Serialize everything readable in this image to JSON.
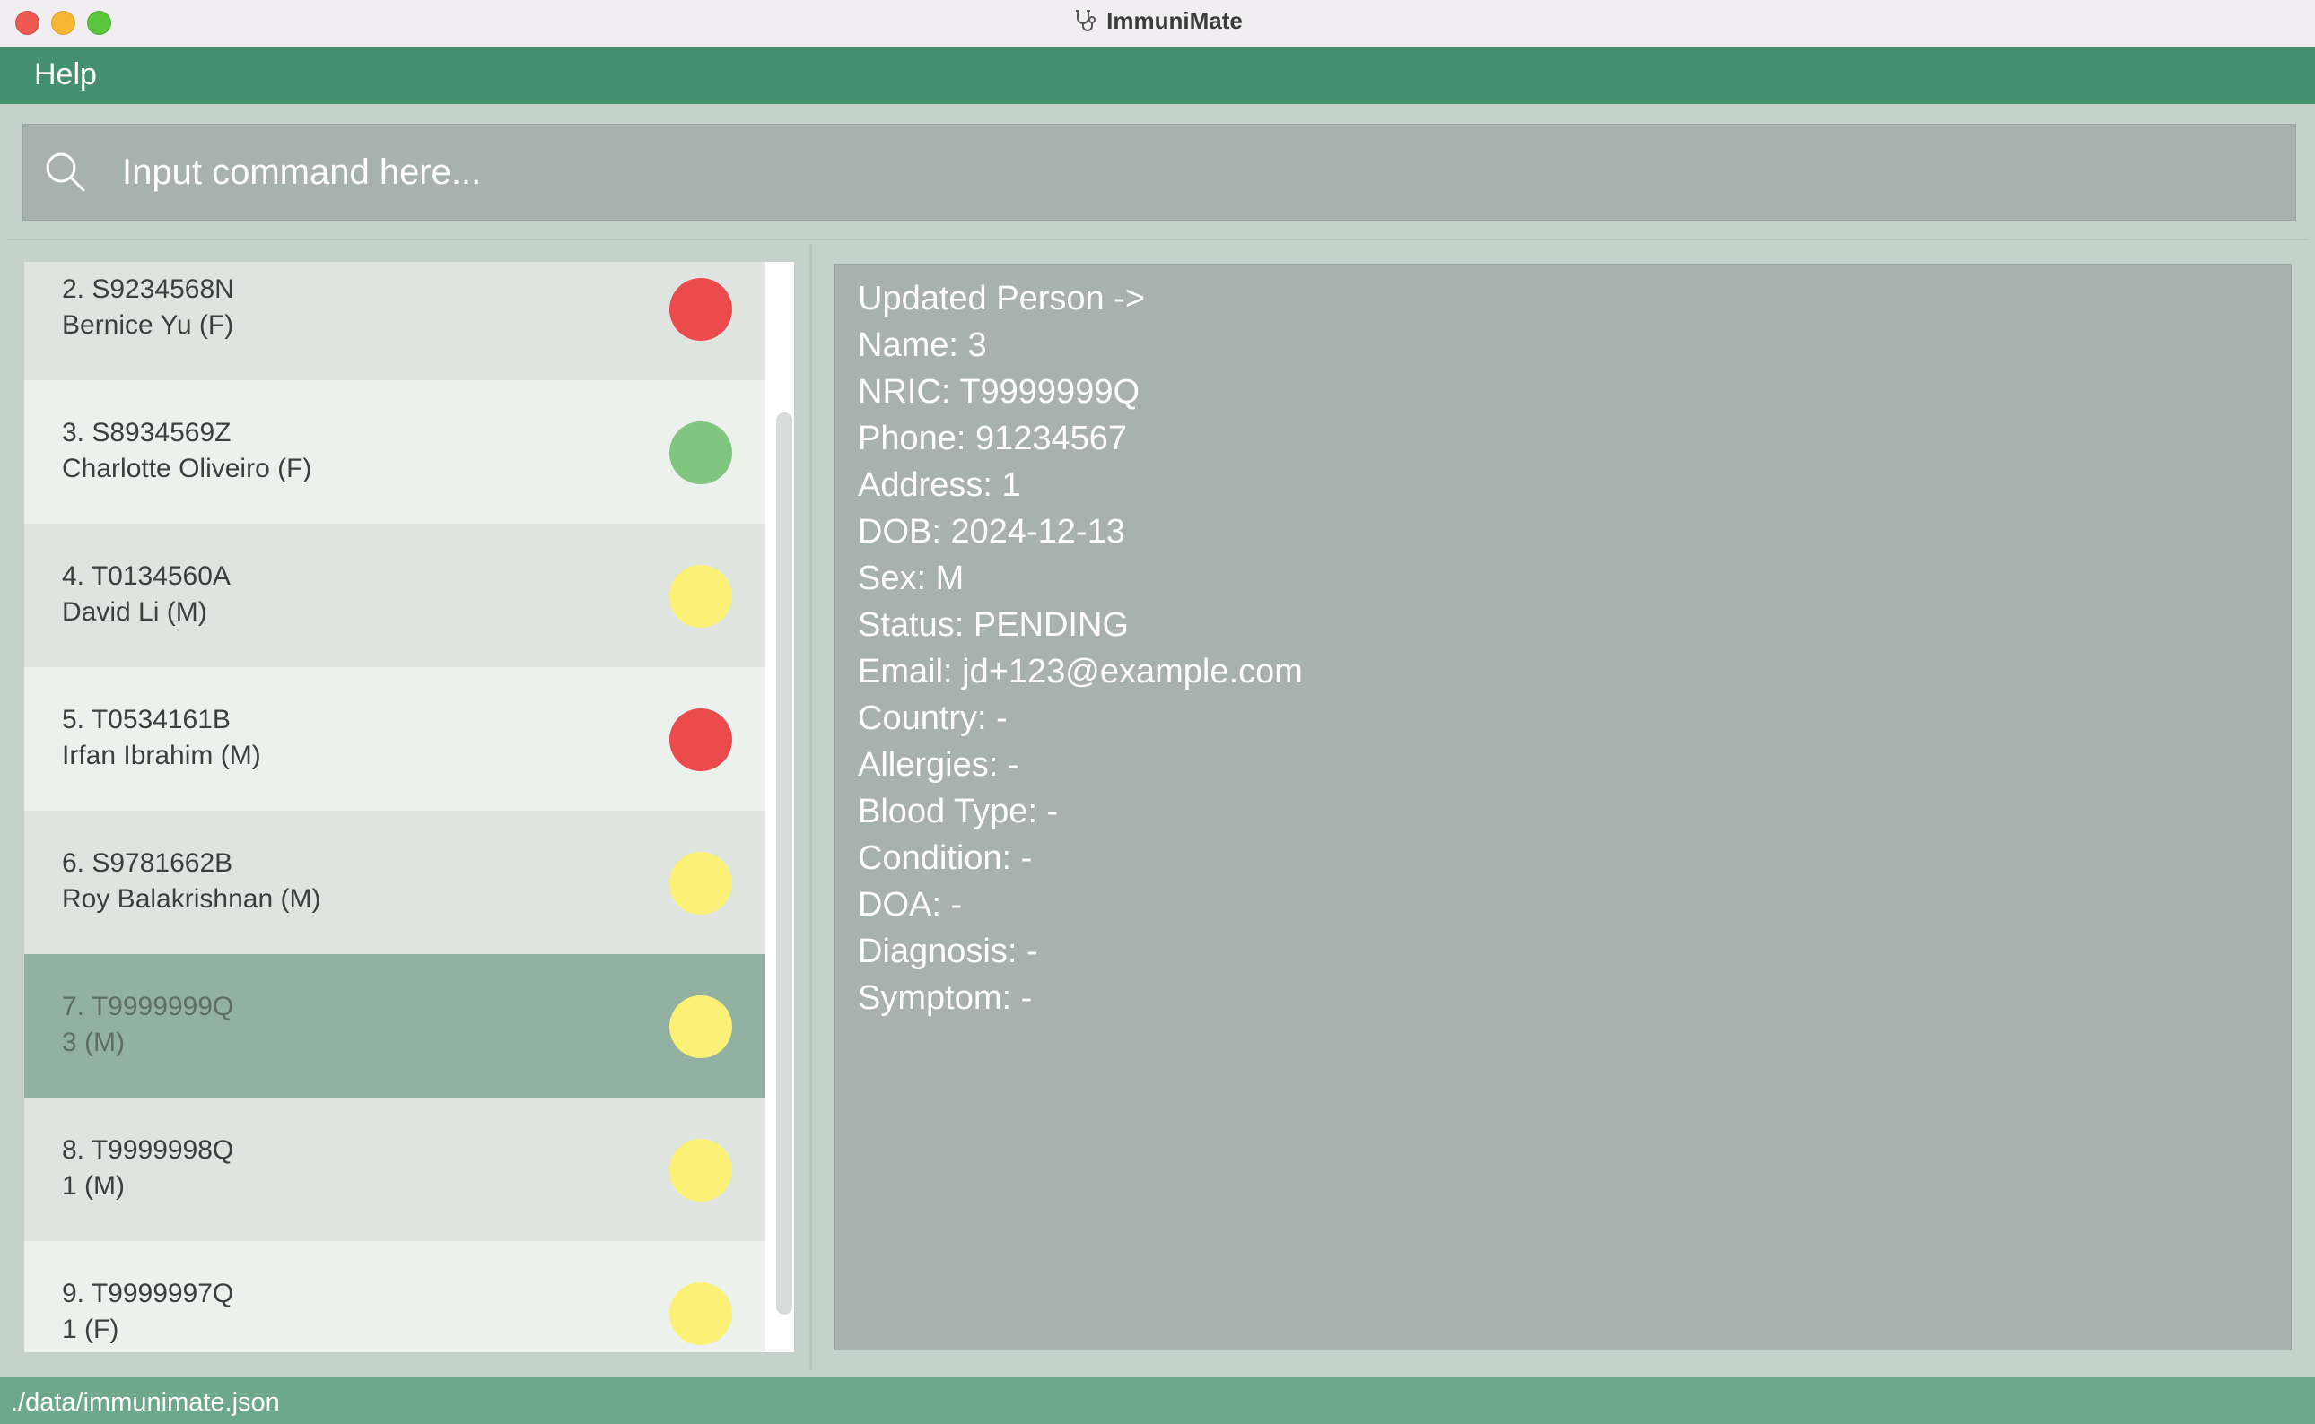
{
  "window": {
    "title": "ImmuniMate"
  },
  "menu": {
    "help_label": "Help"
  },
  "command": {
    "placeholder": "Input command here...",
    "value": ""
  },
  "colors": {
    "red": "#ea4c4d",
    "green": "#80c680",
    "yellow": "#fbf176",
    "selected": "#93b1a2",
    "accent": "#448f6d"
  },
  "persons": [
    {
      "index": "2.",
      "nric": "S9234568N",
      "name_sex": "Bernice Yu (F)",
      "status_color": "red",
      "selected": false
    },
    {
      "index": "3.",
      "nric": "S8934569Z",
      "name_sex": "Charlotte Oliveiro (F)",
      "status_color": "green",
      "selected": false
    },
    {
      "index": "4.",
      "nric": "T0134560A",
      "name_sex": "David Li (M)",
      "status_color": "yellow",
      "selected": false
    },
    {
      "index": "5.",
      "nric": "T0534161B",
      "name_sex": "Irfan Ibrahim (M)",
      "status_color": "red",
      "selected": false
    },
    {
      "index": "6.",
      "nric": "S9781662B",
      "name_sex": "Roy Balakrishnan (M)",
      "status_color": "yellow",
      "selected": false
    },
    {
      "index": "7.",
      "nric": "T9999999Q",
      "name_sex": "3 (M)",
      "status_color": "yellow",
      "selected": true
    },
    {
      "index": "8.",
      "nric": "T9999998Q",
      "name_sex": "1 (M)",
      "status_color": "yellow",
      "selected": false
    },
    {
      "index": "9.",
      "nric": "T9999997Q",
      "name_sex": "1 (F)",
      "status_color": "yellow",
      "selected": false
    }
  ],
  "result": {
    "lines": [
      "Updated Person ->",
      "Name: 3",
      "NRIC: T9999999Q",
      "Phone: 91234567",
      "Address: 1",
      "DOB: 2024-12-13",
      "Sex: M",
      "Status: PENDING",
      "Email: jd+123@example.com",
      "Country: -",
      "Allergies: -",
      "Blood Type: -",
      "Condition: -",
      "DOA: -",
      "Diagnosis: -",
      "Symptom: -"
    ]
  },
  "statusbar": {
    "path": "./data/immunimate.json"
  }
}
